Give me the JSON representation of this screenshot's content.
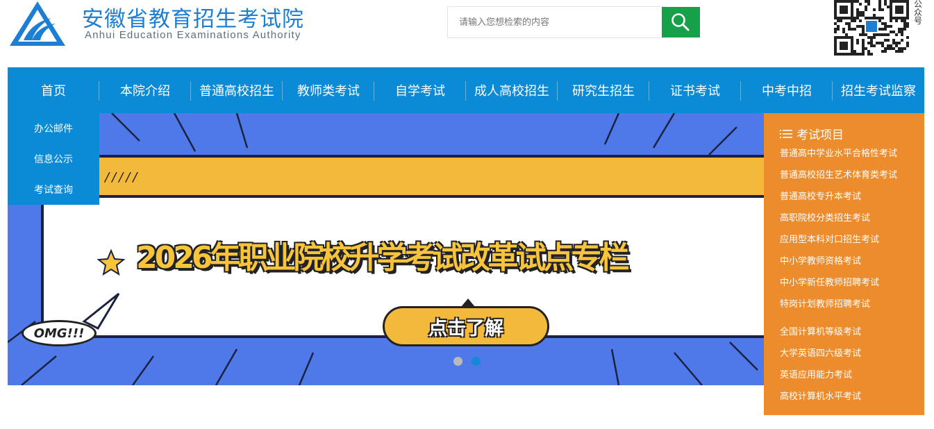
{
  "header": {
    "title": "安徽省教育招生考试院",
    "subtitle": "Anhui Education Examinations Authority",
    "logo_icon": "education-authority-logo-icon"
  },
  "search": {
    "placeholder": "请输入您想检索的内容",
    "button_icon": "search-icon"
  },
  "qr": {
    "label": "公众号"
  },
  "nav": {
    "items": [
      "首页",
      "本院介绍",
      "普通高校招生",
      "教师类考试",
      "自学考试",
      "成人高校招生",
      "研究生招生",
      "证书考试",
      "中考中招",
      "招生考试监察"
    ]
  },
  "subnav": {
    "items": [
      "办公邮件",
      "信息公示",
      "考试查询"
    ]
  },
  "banner": {
    "title": "2026年职业院校升学考试改革试点专栏",
    "button": "点击了解",
    "bubble": "OMG!!!",
    "slashes": "/////",
    "slides_total": 2,
    "active_slide": 2
  },
  "exam_panel": {
    "heading": "考试项目",
    "group1": [
      "普通高中学业水平合格性考试",
      "普通高校招生艺术体育类考试",
      "普通高校专升本考试",
      "高职院校分类招生考试",
      "应用型本科对口招生考试",
      "中小学教师资格考试",
      "中小学新任教师招聘考试",
      "特岗计划教师招聘考试"
    ],
    "group2": [
      "全国计算机等级考试",
      "大学英语四六级考试",
      "英语应用能力考试",
      "高校计算机水平考试"
    ]
  },
  "colors": {
    "brand_blue": "#1d7fd4",
    "nav_blue": "#0b8ad6",
    "search_green": "#17a04a",
    "panel_orange": "#ed8c2c",
    "banner_yellow": "#f3b93a"
  }
}
